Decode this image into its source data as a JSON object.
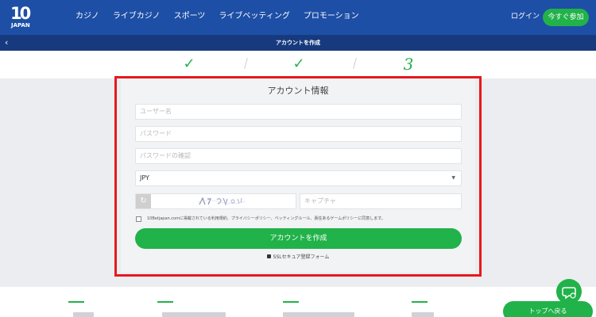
{
  "header": {
    "logo_main": "10",
    "logo_sub": "JAPAN",
    "nav": [
      "カジノ",
      "ライブカジノ",
      "スポーツ",
      "ライブベッティング",
      "プロモーション"
    ],
    "login": "ログイン",
    "signup": "今すぐ参加"
  },
  "titlebar": {
    "back_glyph": "‹",
    "title": "アカウントを作成"
  },
  "steps": {
    "step1": "✓",
    "step2": "✓",
    "step3": "3"
  },
  "form": {
    "heading": "アカウント情報",
    "username_placeholder": "ユーザー名",
    "password_placeholder": "パスワード",
    "password_confirm_placeholder": "パスワードの確認",
    "currency_value": "JPY",
    "captcha_refresh_glyph": "↻",
    "captcha_placeholder": "キャプチャ",
    "agree_text": "10Betjapan.comに掲載されている利用規約、プライバシーポリシー、ベッティングルール、責任あるゲームポリシーに同意します。",
    "submit": "アカウントを作成",
    "ssl_note": "SSLセキュア登録フォーム"
  },
  "footer": {
    "top_button": "トップへ戻る"
  },
  "colors": {
    "brand_blue": "#1e4fa6",
    "title_blue": "#173a7e",
    "accent_green": "#21b24a",
    "highlight_red": "#e6191d"
  }
}
